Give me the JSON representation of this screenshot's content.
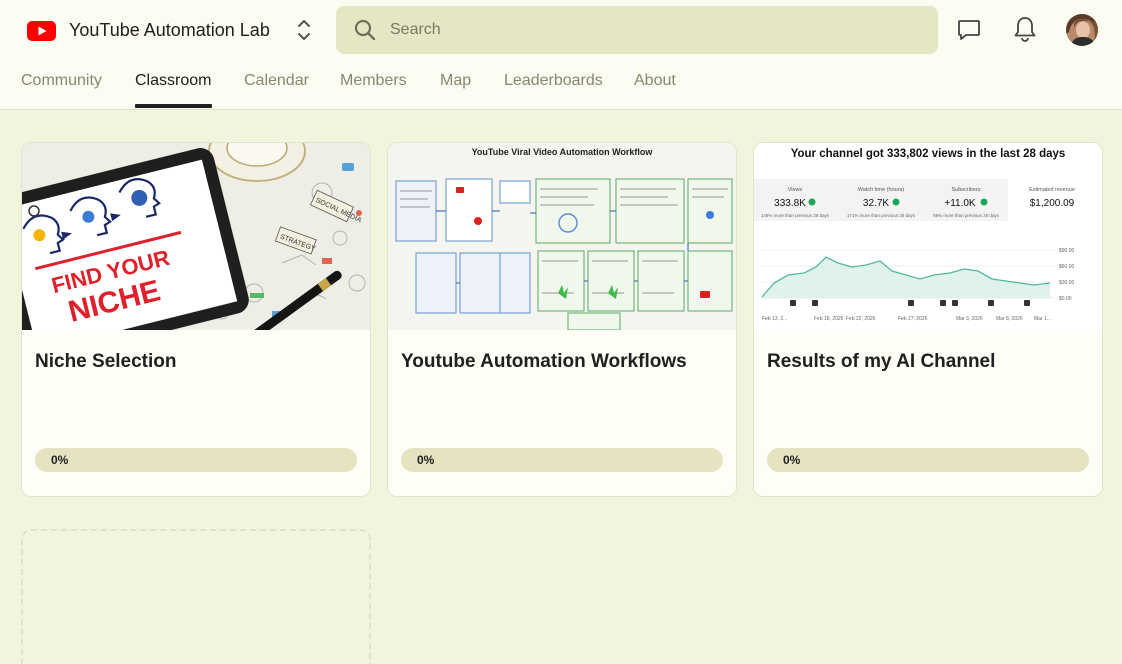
{
  "header": {
    "app_title": "YouTube Automation Lab",
    "search_placeholder": "Search",
    "logo_icon": "youtube-logo-icon",
    "switcher_icon": "chevron-up-down-icon",
    "chat_icon": "chat-bubble-icon",
    "bell_icon": "bell-icon"
  },
  "tabs": [
    {
      "label": "Community",
      "active": false
    },
    {
      "label": "Classroom",
      "active": true
    },
    {
      "label": "Calendar",
      "active": false
    },
    {
      "label": "Members",
      "active": false
    },
    {
      "label": "Map",
      "active": false
    },
    {
      "label": "Leaderboards",
      "active": false
    },
    {
      "label": "About",
      "active": false
    }
  ],
  "courses": [
    {
      "title": "Niche Selection",
      "progress": 0,
      "progress_label": "0%",
      "thumbnail": {
        "board_line1": "FIND YOUR",
        "board_line2": "NICHE",
        "notes": [
          "SOCIAL MEDIA",
          "STRATEGY"
        ]
      }
    },
    {
      "title": "Youtube Automation Workflows",
      "progress": 0,
      "progress_label": "0%",
      "thumbnail": {
        "heading": "YouTube Viral Video Automation Workflow"
      }
    },
    {
      "title": "Results of my AI Channel",
      "progress": 0,
      "progress_label": "0%",
      "thumbnail": {
        "heading": "Your channel got 333,802 views in the last 28 days",
        "stats": [
          {
            "label": "Views",
            "value": "333.8K",
            "sub": "149% more than previous 28 days"
          },
          {
            "label": "Watch time (hours)",
            "value": "32.7K",
            "sub": "171% more than previous 28 days"
          },
          {
            "label": "Subscribers",
            "value": "+11.0K",
            "sub": "89% more than previous 28 days"
          },
          {
            "label": "Estimated revenue",
            "value": "$1,200.09",
            "sub": ""
          }
        ],
        "y_ticks": [
          "$90.00",
          "$60.00",
          "$30.00",
          "$0.00"
        ],
        "x_ticks": [
          "Feb 13, 2...",
          "Feb 18, 2026",
          "Feb 22, 2026",
          "Feb 27, 2026",
          "Mar 3, 2026",
          "Mar 8, 2026",
          "Mar 1..."
        ]
      }
    }
  ],
  "colors": {
    "background": "#f1f5dd",
    "header": "#fbfcf2",
    "search": "#e7e6c4",
    "progress_track": "#e6e3c1",
    "brand_red": "#ff0000",
    "chart_line": "#55b89a"
  }
}
